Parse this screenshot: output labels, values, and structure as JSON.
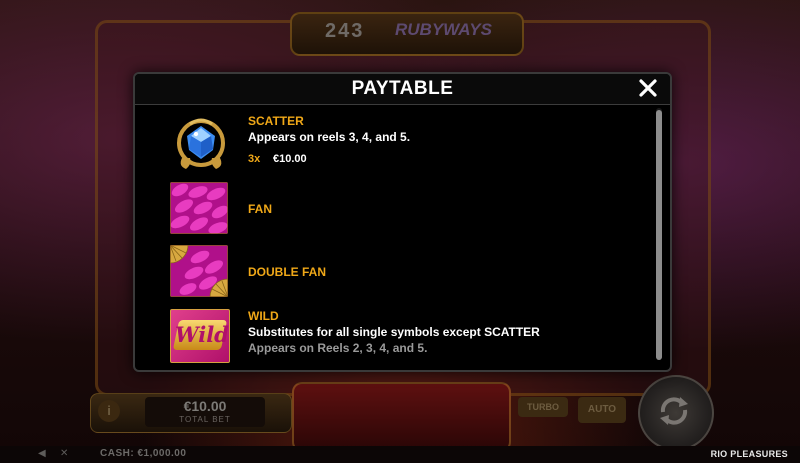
{
  "background": {
    "ways_number": "243",
    "logo_text": "RUBYWAYS",
    "total_bet_value": "€10.00",
    "total_bet_label": "TOTAL BET",
    "info_button_label": "i",
    "turbo_label": "TURBO",
    "auto_label": "AUTO",
    "cash_text": "CASH: €1,000.00",
    "game_name": "RIO PLEASURES"
  },
  "modal": {
    "title": "PAYTABLE",
    "close_icon": "close-icon",
    "symbols": [
      {
        "icon": "scatter-gem-icon",
        "name": "SCATTER",
        "description": "Appears on reels 3, 4, and 5.",
        "pay_multiplier": "3x",
        "pay_value": "€10.00"
      },
      {
        "icon": "fan-icon",
        "name": "FAN"
      },
      {
        "icon": "double-fan-icon",
        "name": "DOUBLE FAN"
      },
      {
        "icon": "wild-icon",
        "name": "WILD",
        "wild_text": "Wild",
        "description": "Substitutes for all single symbols except SCATTER",
        "note": "Appears on Reels 2, 3, 4, and 5."
      }
    ]
  },
  "colors": {
    "accent_orange": "#f0a818",
    "modal_bg": "#000000",
    "fan_pink": "#d81ea8",
    "gem_blue": "#3c8cf0"
  }
}
